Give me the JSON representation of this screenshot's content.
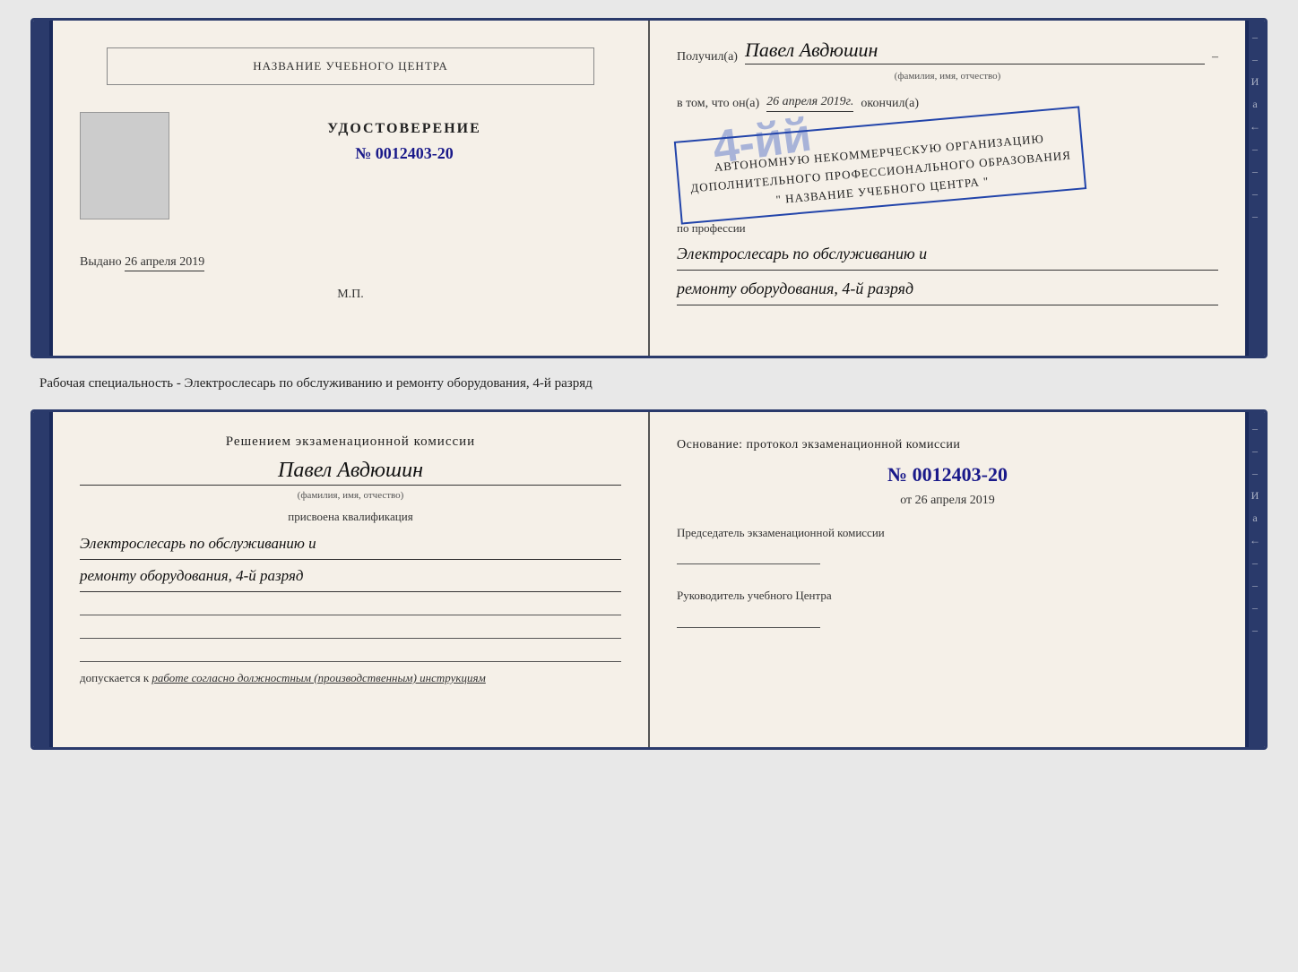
{
  "topDocument": {
    "left": {
      "schoolNameBox": "НАЗВАНИЕ УЧЕБНОГО ЦЕНТРА",
      "certTitle": "УДОСТОВЕРЕНИЕ",
      "certNumber": "№ 0012403-20",
      "issuedLabel": "Выдано",
      "issuedDate": "26 апреля 2019",
      "mpLabel": "М.П."
    },
    "right": {
      "recipientLabel": "Получил(a)",
      "recipientName": "Павел Авдюшин",
      "recipientSubLabel": "(фамилия, имя, отчество)",
      "vtomLabel": "в том, что он(a)",
      "vtomDate": "26 апреля 2019г.",
      "okonchilLabel": "окончил(a)",
      "rankText": "4-й",
      "orgLine1": "АВТОНОМНУЮ НЕКОММЕРЧЕСКУЮ ОРГАНИЗАЦИЮ",
      "orgLine2": "ДОПОЛНИТЕЛЬНОГО ПРОФЕССИОНАЛЬНОГО ОБРАЗОВАНИЯ",
      "orgLine3": "\" НАЗВАНИЕ УЧЕБНОГО ЦЕНТРА \"",
      "professionLabel": "по профессии",
      "professionLine1": "Электрослесарь по обслуживанию и",
      "professionLine2": "ремонту оборудования, 4-й разряд"
    }
  },
  "middleText": "Рабочая специальность - Электрослесарь по обслуживанию и ремонту оборудования, 4-й разряд",
  "bottomDocument": {
    "left": {
      "commissionTitle": "Решением экзаменационной  комиссии",
      "personName": "Павел Авдюшин",
      "personSubLabel": "(фамилия, имя, отчество)",
      "assignedLabel": "присвоена квалификация",
      "qualLine1": "Электрослесарь по обслуживанию и",
      "qualLine2": "ремонту оборудования, 4-й разряд",
      "допускаетсяLabel": "допускается к",
      "допускаетсяText": "работе согласно должностным (производственным) инструкциям"
    },
    "right": {
      "osnovanieLabel": "Основание: протокол экзаменационной  комиссии",
      "protocolNumber": "№  0012403-20",
      "dateLabel": "от",
      "dateValue": "26 апреля 2019",
      "chairmanLabel": "Председатель экзаменационной комиссии",
      "directorLabel": "Руководитель учебного Центра"
    }
  },
  "sideDecorations": {
    "items": [
      "И",
      "а",
      "←",
      "–",
      "–",
      "–",
      "–"
    ]
  }
}
